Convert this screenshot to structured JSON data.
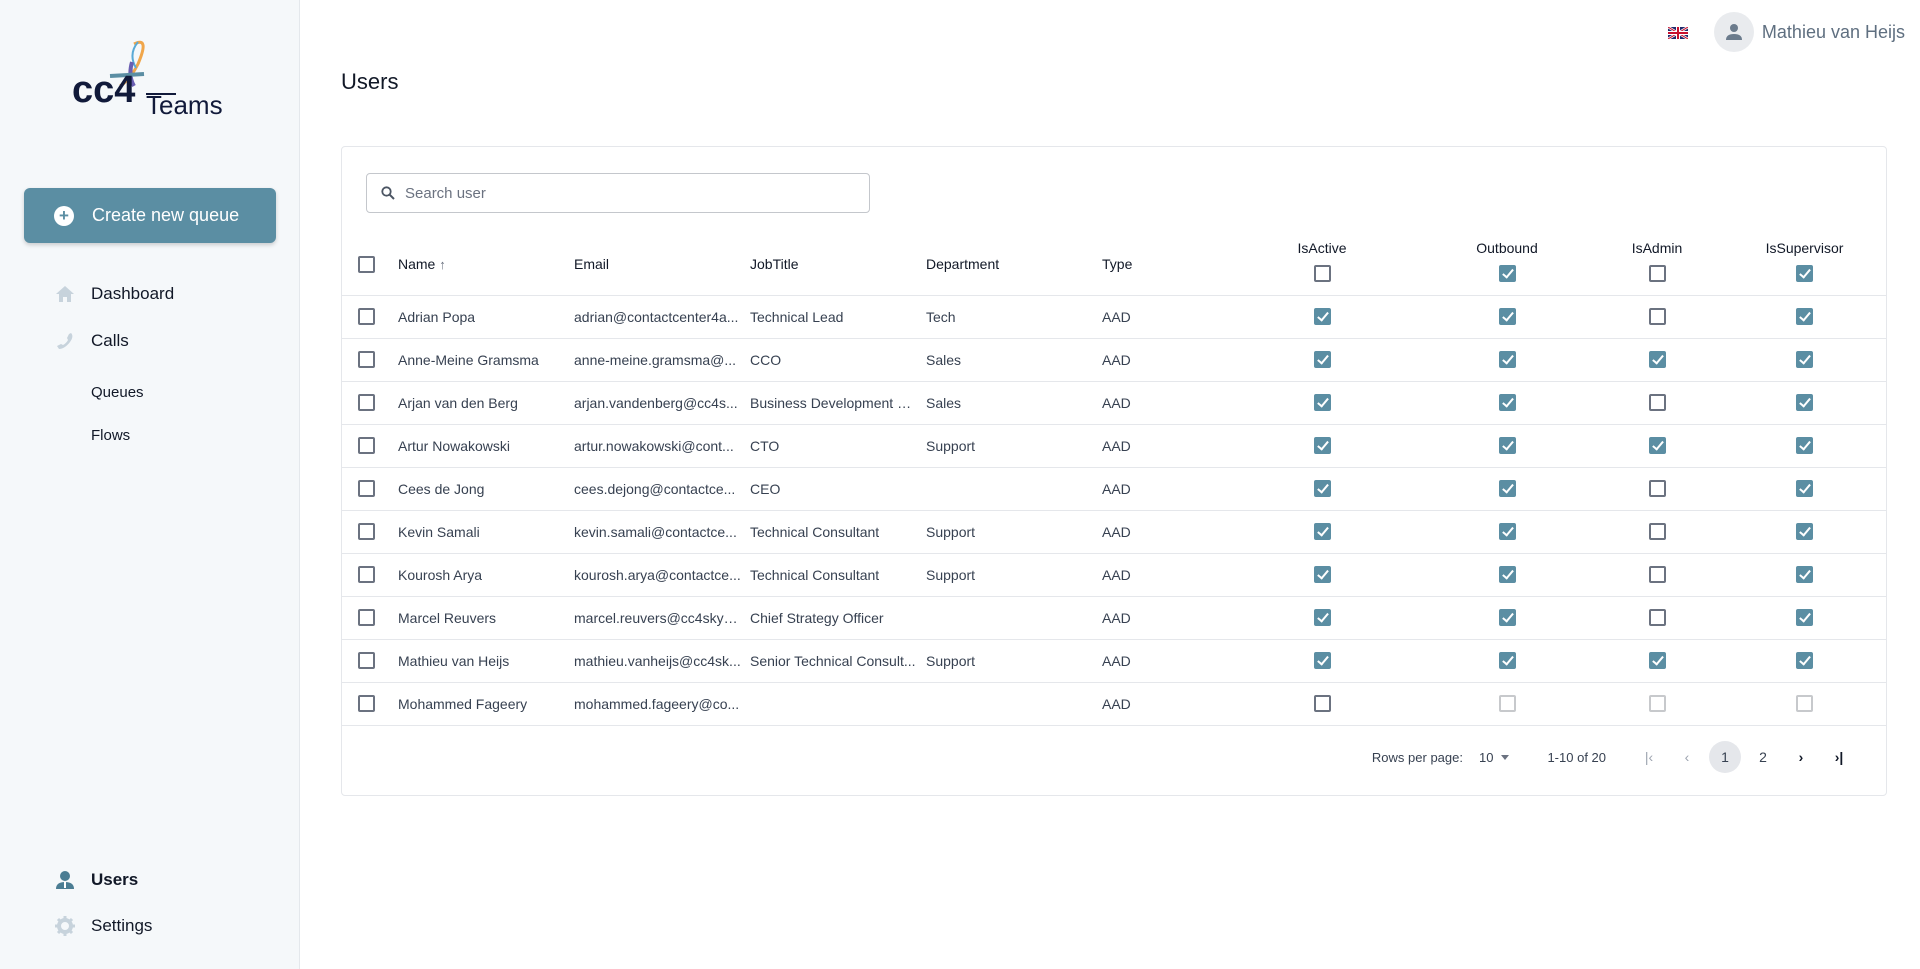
{
  "brand": {
    "logo_text_main": "cc4",
    "logo_text_sub": "Teams",
    "accent": "#5b8ea3"
  },
  "sidebar": {
    "create_button": "Create new queue",
    "items": [
      {
        "label": "Dashboard",
        "icon": "home-icon"
      },
      {
        "label": "Calls",
        "icon": "phone-icon"
      },
      {
        "label": "Queues"
      },
      {
        "label": "Flows"
      },
      {
        "label": "Users",
        "icon": "users-icon",
        "active": true
      },
      {
        "label": "Settings",
        "icon": "gear-icon"
      }
    ]
  },
  "topbar": {
    "language": "English (UK)",
    "user_name": "Mathieu van Heijs"
  },
  "page": {
    "title": "Users"
  },
  "search": {
    "placeholder": "Search user",
    "value": ""
  },
  "table": {
    "columns": [
      "Name",
      "Email",
      "JobTitle",
      "Department",
      "Type",
      "IsActive",
      "Outbound",
      "IsAdmin",
      "IsSupervisor"
    ],
    "sort": {
      "column": "Name",
      "direction": "asc"
    },
    "header_bool_states": {
      "IsActive": false,
      "Outbound": true,
      "IsAdmin": false,
      "IsSupervisor": true
    },
    "rows": [
      {
        "name": "Adrian Popa",
        "email": "adrian@contactcenter4a...",
        "job": "Technical Lead",
        "dept": "Tech",
        "type": "AAD",
        "active": true,
        "outbound": true,
        "admin": false,
        "supervisor": true,
        "disabled": false
      },
      {
        "name": "Anne-Meine Gramsma",
        "email": "anne-meine.gramsma@...",
        "job": "CCO",
        "dept": "Sales",
        "type": "AAD",
        "active": true,
        "outbound": true,
        "admin": true,
        "supervisor": true,
        "disabled": false
      },
      {
        "name": "Arjan van den Berg",
        "email": "arjan.vandenberg@cc4s...",
        "job": "Business Development D...",
        "dept": "Sales",
        "type": "AAD",
        "active": true,
        "outbound": true,
        "admin": false,
        "supervisor": true,
        "disabled": false
      },
      {
        "name": "Artur Nowakowski",
        "email": "artur.nowakowski@cont...",
        "job": "CTO",
        "dept": "Support",
        "type": "AAD",
        "active": true,
        "outbound": true,
        "admin": true,
        "supervisor": true,
        "disabled": false
      },
      {
        "name": "Cees de Jong",
        "email": "cees.dejong@contactce...",
        "job": "CEO",
        "dept": "",
        "type": "AAD",
        "active": true,
        "outbound": true,
        "admin": false,
        "supervisor": true,
        "disabled": false
      },
      {
        "name": "Kevin Samali",
        "email": "kevin.samali@contactce...",
        "job": "Technical Consultant",
        "dept": "Support",
        "type": "AAD",
        "active": true,
        "outbound": true,
        "admin": false,
        "supervisor": true,
        "disabled": false
      },
      {
        "name": "Kourosh Arya",
        "email": "kourosh.arya@contactce...",
        "job": "Technical Consultant",
        "dept": "Support",
        "type": "AAD",
        "active": true,
        "outbound": true,
        "admin": false,
        "supervisor": true,
        "disabled": false
      },
      {
        "name": "Marcel Reuvers",
        "email": "marcel.reuvers@cc4skyp...",
        "job": "Chief Strategy Officer",
        "dept": "",
        "type": "AAD",
        "active": true,
        "outbound": true,
        "admin": false,
        "supervisor": true,
        "disabled": false
      },
      {
        "name": "Mathieu van Heijs",
        "email": "mathieu.vanheijs@cc4sk...",
        "job": "Senior Technical Consult...",
        "dept": "Support",
        "type": "AAD",
        "active": true,
        "outbound": true,
        "admin": true,
        "supervisor": true,
        "disabled": false
      },
      {
        "name": "Mohammed Fageery",
        "email": "mohammed.fageery@co...",
        "job": "",
        "dept": "",
        "type": "AAD",
        "active": false,
        "outbound": false,
        "admin": false,
        "supervisor": false,
        "disabled": true
      }
    ]
  },
  "pagination": {
    "rows_per_page_label": "Rows per page:",
    "rows_per_page": "10",
    "range": "1-10 of 20",
    "pages": [
      "1",
      "2"
    ],
    "current_page": "1"
  }
}
